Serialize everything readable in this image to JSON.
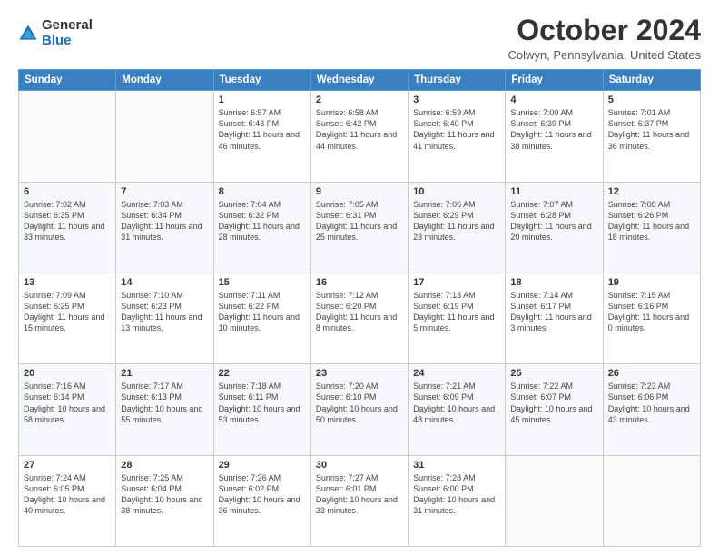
{
  "logo": {
    "general": "General",
    "blue": "Blue"
  },
  "title": {
    "month": "October 2024",
    "location": "Colwyn, Pennsylvania, United States"
  },
  "days_of_week": [
    "Sunday",
    "Monday",
    "Tuesday",
    "Wednesday",
    "Thursday",
    "Friday",
    "Saturday"
  ],
  "weeks": [
    [
      {
        "day": "",
        "content": ""
      },
      {
        "day": "",
        "content": ""
      },
      {
        "day": "1",
        "content": "Sunrise: 6:57 AM\nSunset: 6:43 PM\nDaylight: 11 hours and 46 minutes."
      },
      {
        "day": "2",
        "content": "Sunrise: 6:58 AM\nSunset: 6:42 PM\nDaylight: 11 hours and 44 minutes."
      },
      {
        "day": "3",
        "content": "Sunrise: 6:59 AM\nSunset: 6:40 PM\nDaylight: 11 hours and 41 minutes."
      },
      {
        "day": "4",
        "content": "Sunrise: 7:00 AM\nSunset: 6:39 PM\nDaylight: 11 hours and 38 minutes."
      },
      {
        "day": "5",
        "content": "Sunrise: 7:01 AM\nSunset: 6:37 PM\nDaylight: 11 hours and 36 minutes."
      }
    ],
    [
      {
        "day": "6",
        "content": "Sunrise: 7:02 AM\nSunset: 6:35 PM\nDaylight: 11 hours and 33 minutes."
      },
      {
        "day": "7",
        "content": "Sunrise: 7:03 AM\nSunset: 6:34 PM\nDaylight: 11 hours and 31 minutes."
      },
      {
        "day": "8",
        "content": "Sunrise: 7:04 AM\nSunset: 6:32 PM\nDaylight: 11 hours and 28 minutes."
      },
      {
        "day": "9",
        "content": "Sunrise: 7:05 AM\nSunset: 6:31 PM\nDaylight: 11 hours and 25 minutes."
      },
      {
        "day": "10",
        "content": "Sunrise: 7:06 AM\nSunset: 6:29 PM\nDaylight: 11 hours and 23 minutes."
      },
      {
        "day": "11",
        "content": "Sunrise: 7:07 AM\nSunset: 6:28 PM\nDaylight: 11 hours and 20 minutes."
      },
      {
        "day": "12",
        "content": "Sunrise: 7:08 AM\nSunset: 6:26 PM\nDaylight: 11 hours and 18 minutes."
      }
    ],
    [
      {
        "day": "13",
        "content": "Sunrise: 7:09 AM\nSunset: 6:25 PM\nDaylight: 11 hours and 15 minutes."
      },
      {
        "day": "14",
        "content": "Sunrise: 7:10 AM\nSunset: 6:23 PM\nDaylight: 11 hours and 13 minutes."
      },
      {
        "day": "15",
        "content": "Sunrise: 7:11 AM\nSunset: 6:22 PM\nDaylight: 11 hours and 10 minutes."
      },
      {
        "day": "16",
        "content": "Sunrise: 7:12 AM\nSunset: 6:20 PM\nDaylight: 11 hours and 8 minutes."
      },
      {
        "day": "17",
        "content": "Sunrise: 7:13 AM\nSunset: 6:19 PM\nDaylight: 11 hours and 5 minutes."
      },
      {
        "day": "18",
        "content": "Sunrise: 7:14 AM\nSunset: 6:17 PM\nDaylight: 11 hours and 3 minutes."
      },
      {
        "day": "19",
        "content": "Sunrise: 7:15 AM\nSunset: 6:16 PM\nDaylight: 11 hours and 0 minutes."
      }
    ],
    [
      {
        "day": "20",
        "content": "Sunrise: 7:16 AM\nSunset: 6:14 PM\nDaylight: 10 hours and 58 minutes."
      },
      {
        "day": "21",
        "content": "Sunrise: 7:17 AM\nSunset: 6:13 PM\nDaylight: 10 hours and 55 minutes."
      },
      {
        "day": "22",
        "content": "Sunrise: 7:18 AM\nSunset: 6:11 PM\nDaylight: 10 hours and 53 minutes."
      },
      {
        "day": "23",
        "content": "Sunrise: 7:20 AM\nSunset: 6:10 PM\nDaylight: 10 hours and 50 minutes."
      },
      {
        "day": "24",
        "content": "Sunrise: 7:21 AM\nSunset: 6:09 PM\nDaylight: 10 hours and 48 minutes."
      },
      {
        "day": "25",
        "content": "Sunrise: 7:22 AM\nSunset: 6:07 PM\nDaylight: 10 hours and 45 minutes."
      },
      {
        "day": "26",
        "content": "Sunrise: 7:23 AM\nSunset: 6:06 PM\nDaylight: 10 hours and 43 minutes."
      }
    ],
    [
      {
        "day": "27",
        "content": "Sunrise: 7:24 AM\nSunset: 6:05 PM\nDaylight: 10 hours and 40 minutes."
      },
      {
        "day": "28",
        "content": "Sunrise: 7:25 AM\nSunset: 6:04 PM\nDaylight: 10 hours and 38 minutes."
      },
      {
        "day": "29",
        "content": "Sunrise: 7:26 AM\nSunset: 6:02 PM\nDaylight: 10 hours and 36 minutes."
      },
      {
        "day": "30",
        "content": "Sunrise: 7:27 AM\nSunset: 6:01 PM\nDaylight: 10 hours and 33 minutes."
      },
      {
        "day": "31",
        "content": "Sunrise: 7:28 AM\nSunset: 6:00 PM\nDaylight: 10 hours and 31 minutes."
      },
      {
        "day": "",
        "content": ""
      },
      {
        "day": "",
        "content": ""
      }
    ]
  ]
}
